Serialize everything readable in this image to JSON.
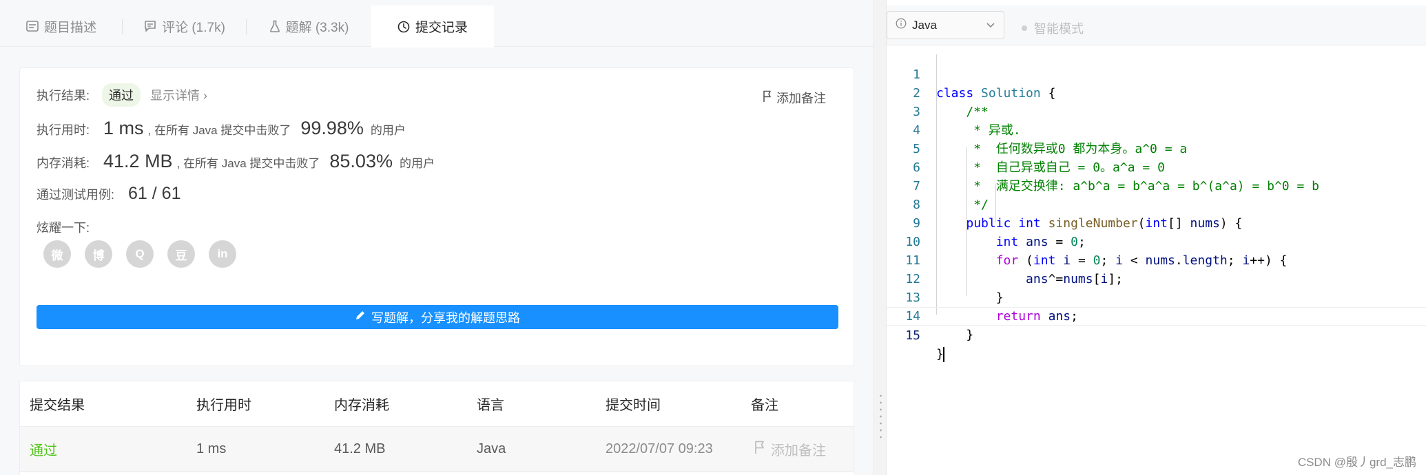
{
  "tabs": [
    {
      "label": "题目描述",
      "icon": "description-icon"
    },
    {
      "label": "评论 (1.7k)",
      "icon": "comment-icon"
    },
    {
      "label": "题解 (3.3k)",
      "icon": "flask-icon"
    },
    {
      "label": "提交记录",
      "icon": "clock-icon",
      "active": true
    }
  ],
  "result": {
    "status_label": "执行结果:",
    "status": "通过",
    "show_detail": "显示详情 ›",
    "add_note": "添加备注",
    "time_label": "执行用时:",
    "time_value": "1 ms",
    "time_mid": ", 在所有 Java 提交中击败了",
    "time_pct": "99.98%",
    "time_suffix": "的用户",
    "mem_label": "内存消耗:",
    "mem_value": "41.2 MB",
    "mem_mid": ", 在所有 Java 提交中击败了",
    "mem_pct": "85.03%",
    "mem_suffix": "的用户",
    "cases_label": "通过测试用例:",
    "cases_value": "61  /  61",
    "share_label": "炫耀一下:",
    "share_icons": [
      "wechat-icon",
      "weibo-icon",
      "qq-icon",
      "douban-icon",
      "linkedin-icon"
    ],
    "share_glyphs": [
      "微",
      "博",
      "Q",
      "豆",
      "in"
    ],
    "write_button": "写题解，分享我的解题思路"
  },
  "table": {
    "headers": [
      "提交结果",
      "执行用时",
      "内存消耗",
      "语言",
      "提交时间",
      "备注"
    ],
    "rows": [
      {
        "status": "通过",
        "time": "1 ms",
        "memory": "41.2 MB",
        "language": "Java",
        "submitted": "2022/07/07 09:23",
        "note": "添加备注"
      }
    ]
  },
  "editor": {
    "language": "Java",
    "smart_mode": "智能模式",
    "lines": [
      "1",
      "2",
      "3",
      "4",
      "5",
      "6",
      "7",
      "8",
      "9",
      "10",
      "11",
      "12",
      "13",
      "14",
      "15"
    ],
    "current_line": 15
  },
  "watermark": "CSDN @殷丿grd_志鹏",
  "colors": {
    "accent": "#1890ff",
    "success": "#52c41a",
    "line_number": "#237893"
  }
}
